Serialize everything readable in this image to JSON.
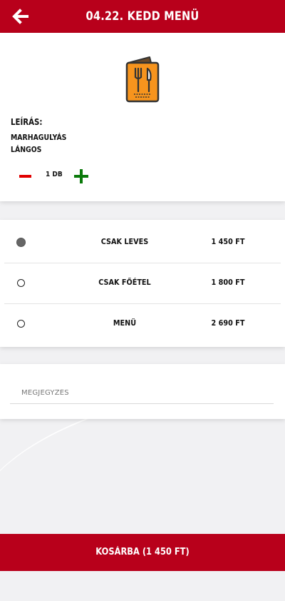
{
  "header": {
    "title": "04.22. KEDD MENÜ",
    "back_icon": "arrow-left-icon",
    "background": "#b8001b"
  },
  "product": {
    "icon": "menu-cutlery-icon",
    "description_label": "LEÍRÁS:",
    "description_lines": [
      "MARHAGULYÁS",
      "LÁNGOS"
    ],
    "quantity": "1 DB"
  },
  "options": [
    {
      "name": "CSAK  LEVES",
      "price": "1 450 FT",
      "selected": true
    },
    {
      "name": "CSAK  FŐÉTEL",
      "price": "1 800 FT",
      "selected": false
    },
    {
      "name": "MENÜ",
      "price": "2 690 FT",
      "selected": false
    }
  ],
  "note": {
    "placeholder": "MEGJEGYZÉS"
  },
  "cart": {
    "label": "KOSÁRBA (1 450 FT)"
  },
  "colors": {
    "brand_red": "#b8001b",
    "minus_red": "#e10000",
    "plus_green": "#0a7a0a",
    "menu_icon_orange": "#f7941d"
  }
}
